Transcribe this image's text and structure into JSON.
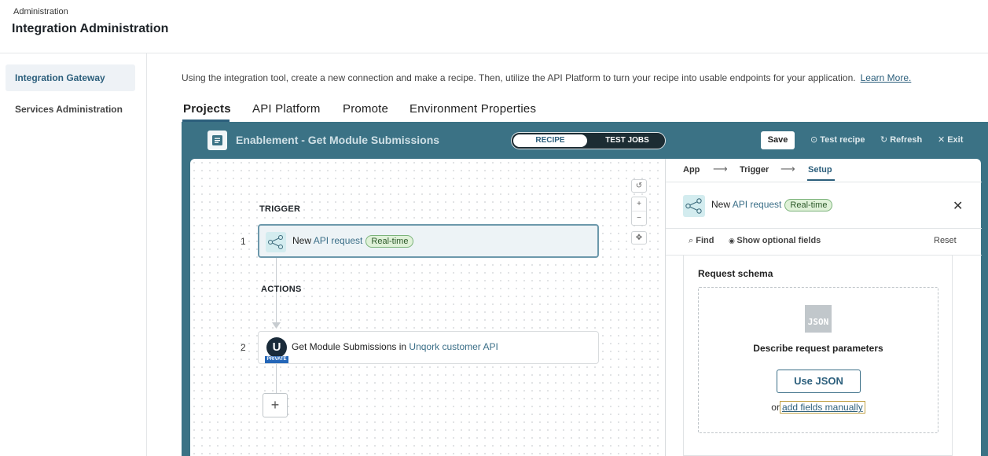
{
  "header": {
    "breadcrumb": "Administration",
    "title": "Integration Administration"
  },
  "sidebar": {
    "items": [
      {
        "label": "Integration Gateway",
        "active": true
      },
      {
        "label": "Services Administration",
        "active": false
      }
    ]
  },
  "intro": {
    "text": "Using the integration tool, create a new connection and make a recipe. Then, utilize the API Platform to turn your recipe into usable endpoints for your application.",
    "link": "Learn More."
  },
  "tabs": [
    "Projects",
    "API  Platform",
    "Promote",
    "Environment  Properties"
  ],
  "recipe": {
    "title": "Enablement - Get Module Submissions",
    "toggle": [
      "RECIPE",
      "TEST JOBS"
    ],
    "save_label": "Save",
    "test_label": "Test recipe",
    "refresh_label": "Refresh",
    "exit_label": "Exit"
  },
  "canvas": {
    "trigger_label": "TRIGGER",
    "actions_label": "ACTIONS",
    "steps": [
      {
        "num": "1",
        "prefix": "New",
        "link": "API request",
        "badge": "Real-time"
      },
      {
        "num": "2",
        "prefix": "Get Module Submissions in",
        "link": "Unqork customer API",
        "icon_letter": "U",
        "icon_tag": "PRIVATE"
      }
    ],
    "zoom": {
      "reset": "↺",
      "in": "+",
      "out": "−",
      "fit": "✥"
    },
    "add": "+"
  },
  "panel": {
    "crumbs": [
      "App",
      "Trigger",
      "Setup"
    ],
    "arrow": "⟶",
    "head": {
      "prefix": "New",
      "link": "API request",
      "badge": "Real-time"
    },
    "close": "✕",
    "find": "Find",
    "optional": "Show optional fields",
    "reset": "Reset",
    "schema_label": "Request schema",
    "json_icon": "JSON",
    "describe": "Describe request parameters",
    "use_json": "Use JSON",
    "or": "or",
    "add_fields": "add fields manually"
  }
}
